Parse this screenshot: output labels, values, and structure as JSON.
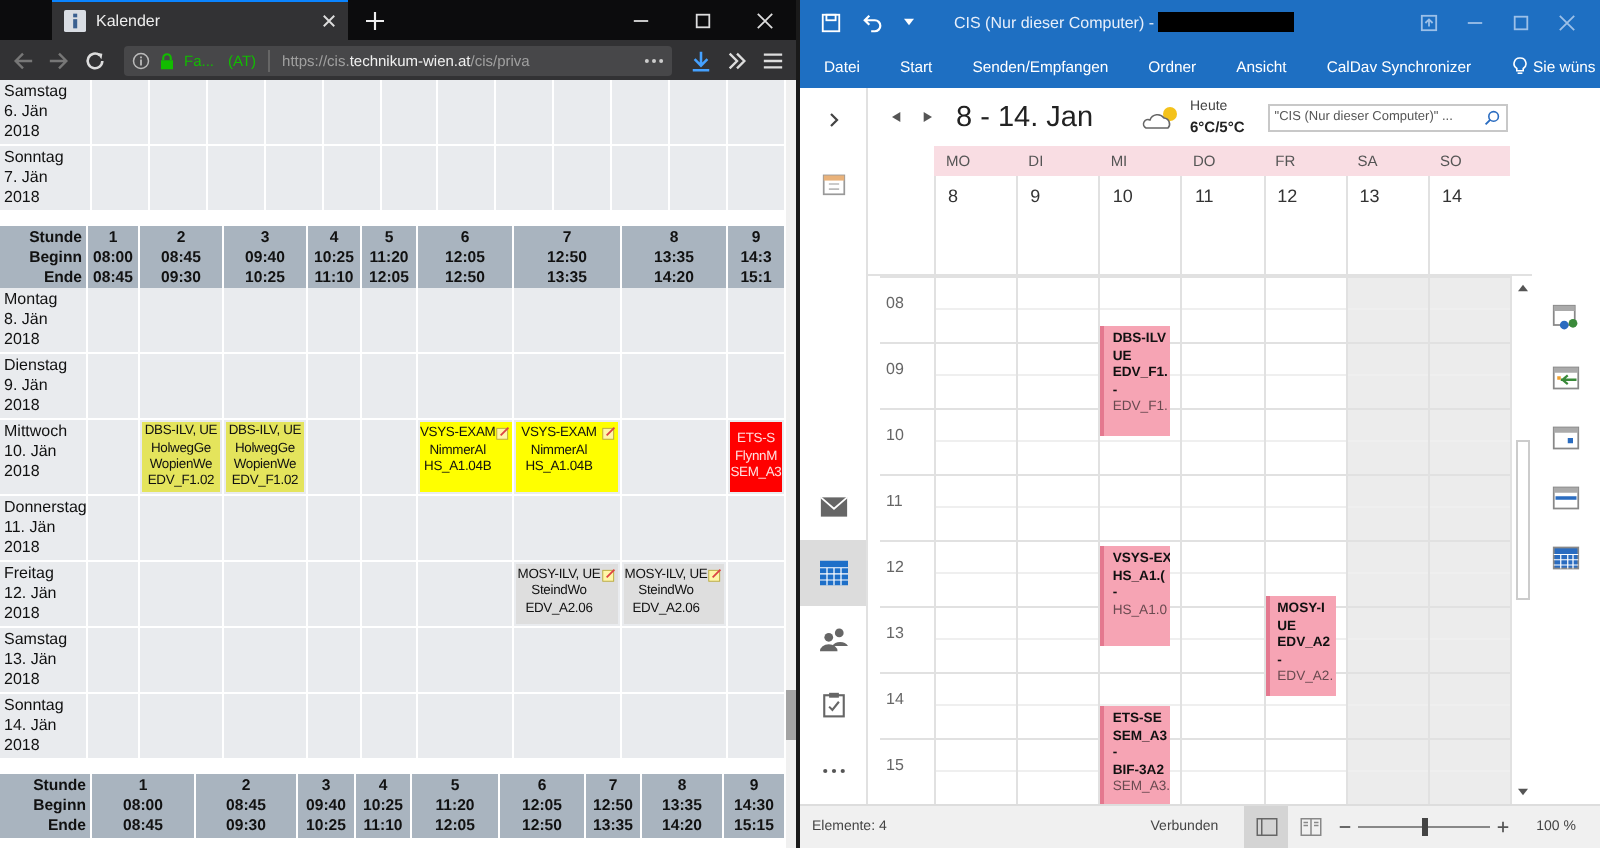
{
  "browser": {
    "tab": {
      "title": "Kalender"
    },
    "site_identity": {
      "org": "Fa...",
      "country": "(AT)"
    },
    "url": {
      "before": "https://cis.",
      "domain": "technikum-wien.at",
      "after": "/cis/priva"
    },
    "weeks": [
      {
        "rows": [
          {
            "weekday": "Samstag",
            "date": "6. Jän",
            "year": "2018",
            "cells": [
              null,
              null,
              null,
              null,
              null,
              null,
              null,
              null,
              null,
              null,
              null,
              null
            ]
          },
          {
            "weekday": "Sonntag",
            "date": "7. Jän",
            "year": "2018",
            "cells": [
              null,
              null,
              null,
              null,
              null,
              null,
              null,
              null,
              null,
              null,
              null,
              null
            ]
          }
        ]
      },
      {
        "header": {
          "labels": [
            "Stunde",
            "Beginn",
            "Ende"
          ],
          "periods": [
            {
              "number": "1",
              "start": "08:00",
              "end": "08:45"
            },
            {
              "number": "2",
              "start": "08:45",
              "end": "09:30"
            },
            {
              "number": "3",
              "start": "09:40",
              "end": "10:25"
            },
            {
              "number": "4",
              "start": "10:25",
              "end": "11:10"
            },
            {
              "number": "5",
              "start": "11:20",
              "end": "12:05"
            },
            {
              "number": "6",
              "start": "12:05",
              "end": "12:50"
            },
            {
              "number": "7",
              "start": "12:50",
              "end": "13:35"
            },
            {
              "number": "8",
              "start": "13:35",
              "end": "14:20"
            },
            {
              "number": "9",
              "start": "14:3",
              "end": "15:1"
            }
          ]
        },
        "rows": [
          {
            "weekday": "Montag",
            "date": "8. Jän",
            "year": "2018",
            "cells": [
              null,
              null,
              null,
              null,
              null,
              null,
              null,
              null,
              null
            ]
          },
          {
            "weekday": "Dienstag",
            "date": "9. Jän",
            "year": "2018",
            "cells": [
              null,
              null,
              null,
              null,
              null,
              null,
              null,
              null,
              null
            ]
          },
          {
            "weekday": "Mittwoch",
            "date": "10. Jän",
            "year": "2018",
            "cells": [
              null,
              {
                "lines": [
                  "DBS-ILV, UE",
                  "HolwegGe",
                  "WopienWe",
                  "EDV_F1.02"
                ],
                "color": "#e4e45c",
                "note": false
              },
              {
                "lines": [
                  "DBS-ILV, UE",
                  "HolwegGe",
                  "WopienWe",
                  "EDV_F1.02"
                ],
                "color": "#e4e45c",
                "note": false
              },
              null,
              null,
              {
                "lines": [
                  "VSYS-EXAM",
                  "NimmerAl",
                  "HS_A1.04B"
                ],
                "color": "#ffff00",
                "note": true
              },
              {
                "lines": [
                  "VSYS-EXAM",
                  "NimmerAl",
                  "HS_A1.04B"
                ],
                "color": "#ffff00",
                "note": true
              },
              null,
              {
                "lines": [
                  "ETS-S",
                  "FlynnM",
                  "SEM_A3"
                ],
                "color": "#ff0000",
                "note": false
              }
            ]
          },
          {
            "weekday": "Donnerstag",
            "date": "11. Jän",
            "year": "2018",
            "cells": [
              null,
              null,
              null,
              null,
              null,
              null,
              null,
              null,
              null
            ]
          },
          {
            "weekday": "Freitag",
            "date": "12. Jän",
            "year": "2018",
            "cells": [
              null,
              null,
              null,
              null,
              null,
              null,
              {
                "lines": [
                  "MOSY-ILV, UE",
                  "SteindWo",
                  "EDV_A2.06"
                ],
                "color": "#dedede",
                "note": true
              },
              {
                "lines": [
                  "MOSY-ILV, UE",
                  "SteindWo",
                  "EDV_A2.06"
                ],
                "color": "#dedede",
                "note": true
              },
              null
            ]
          },
          {
            "weekday": "Samstag",
            "date": "13. Jän",
            "year": "2018",
            "cells": [
              null,
              null,
              null,
              null,
              null,
              null,
              null,
              null,
              null
            ]
          },
          {
            "weekday": "Sonntag",
            "date": "14. Jän",
            "year": "2018",
            "cells": [
              null,
              null,
              null,
              null,
              null,
              null,
              null,
              null,
              null
            ]
          }
        ]
      },
      {
        "header": {
          "labels": [
            "Stunde",
            "Beginn",
            "Ende"
          ],
          "periods": [
            {
              "number": "1",
              "start": "08:00",
              "end": "08:45"
            },
            {
              "number": "2",
              "start": "08:45",
              "end": "09:30"
            },
            {
              "number": "3",
              "start": "09:40",
              "end": "10:25"
            },
            {
              "number": "4",
              "start": "10:25",
              "end": "11:10"
            },
            {
              "number": "5",
              "start": "11:20",
              "end": "12:05"
            },
            {
              "number": "6",
              "start": "12:05",
              "end": "12:50"
            },
            {
              "number": "7",
              "start": "12:50",
              "end": "13:35"
            },
            {
              "number": "8",
              "start": "13:35",
              "end": "14:20"
            },
            {
              "number": "9",
              "start": "14:30",
              "end": "15:15"
            }
          ]
        }
      }
    ]
  },
  "outlook": {
    "title": "CIS (Nur dieser Computer) - ",
    "ribbon_tabs": [
      "Datei",
      "Start",
      "Senden/Empfangen",
      "Ordner",
      "Ansicht",
      "CalDav Synchronizer"
    ],
    "tell_me": "Sie wüns",
    "nav_items": [
      {
        "kind": "mail",
        "selected": false
      },
      {
        "kind": "calendar",
        "selected": true
      },
      {
        "kind": "people",
        "selected": false
      },
      {
        "kind": "tasks",
        "selected": false
      },
      {
        "kind": "more",
        "selected": false
      }
    ],
    "date_range": "8 - 14. Jan",
    "weather": {
      "label": "Heute",
      "temperature": "6°C/5°C"
    },
    "search": {
      "placeholder": "\"CIS (Nur dieser Computer)\" ..."
    },
    "days": [
      {
        "abbr": "MO",
        "date": "8",
        "weekend": false
      },
      {
        "abbr": "DI",
        "date": "9",
        "weekend": false
      },
      {
        "abbr": "MI",
        "date": "10",
        "weekend": false,
        "events": [
          {
            "lines": [
              "DBS-ILV",
              "UE",
              "EDV_F1.",
              "-"
            ],
            "location": "EDV_F1."
          },
          {
            "lines": [
              "VSYS-EX",
              "HS_A1.(",
              "-"
            ],
            "location": "HS_A1.0"
          },
          {
            "lines": [
              "ETS-SE",
              "SEM_A3",
              "-",
              "BIF-3A2"
            ],
            "location": "SEM_A3."
          }
        ]
      },
      {
        "abbr": "DO",
        "date": "11",
        "weekend": false
      },
      {
        "abbr": "FR",
        "date": "12",
        "weekend": false,
        "events": [
          {
            "lines": [
              "MOSY-I",
              "UE",
              "EDV_A2",
              "-"
            ],
            "location": "EDV_A2."
          }
        ]
      },
      {
        "abbr": "SA",
        "date": "13",
        "weekend": true
      },
      {
        "abbr": "SO",
        "date": "14",
        "weekend": true
      }
    ],
    "hours": [
      "08",
      "09",
      "10",
      "11",
      "12",
      "13",
      "14",
      "15"
    ],
    "status": {
      "items": "Elemente: 4",
      "connection": "Verbunden",
      "views": [
        {
          "kind": "normal",
          "selected": true
        },
        {
          "kind": "reading",
          "selected": false
        }
      ],
      "zoom_slider": {
        "level": 0.5
      },
      "zoom": "100 %"
    }
  }
}
